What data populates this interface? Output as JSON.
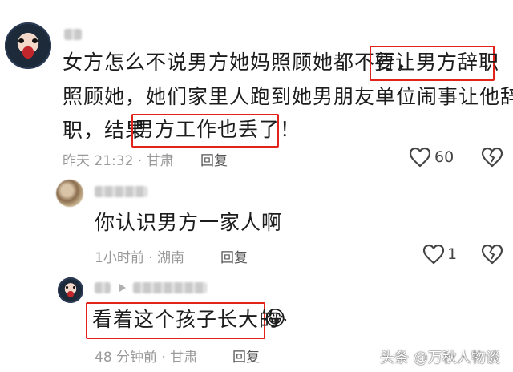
{
  "comment1": {
    "line1_prefix": "女方怎么不说男方她妈照顾她都不行，",
    "line1_boxed": "要让男方辞职",
    "line2": "照顾她，她们家里人跑到她男朋友单位闹事让他辞",
    "line3_prefix": "职，结果",
    "line3_boxed": "男方工作也丢了！",
    "time": "昨天 21:32 · 甘肃",
    "reply_label": "回复",
    "like_count": "60"
  },
  "comment2": {
    "text": "你认识男方一家人啊",
    "time": "1小时前 · 湖南",
    "reply_label": "回复",
    "like_count": "1"
  },
  "comment3": {
    "text": "看着这个孩子长大的",
    "emoji": "😂",
    "time": "48 分钟前 · 甘肃",
    "reply_label": "回复"
  },
  "watermark": {
    "text": "头条 @万秋人物谈"
  },
  "colors": {
    "highlight_box": "#e2231a",
    "meta_text": "#9a9a9a",
    "watermark_text": "#ffffff"
  },
  "icons": [
    "heart-outline-icon",
    "broken-heart-icon",
    "play-triangle-icon"
  ]
}
